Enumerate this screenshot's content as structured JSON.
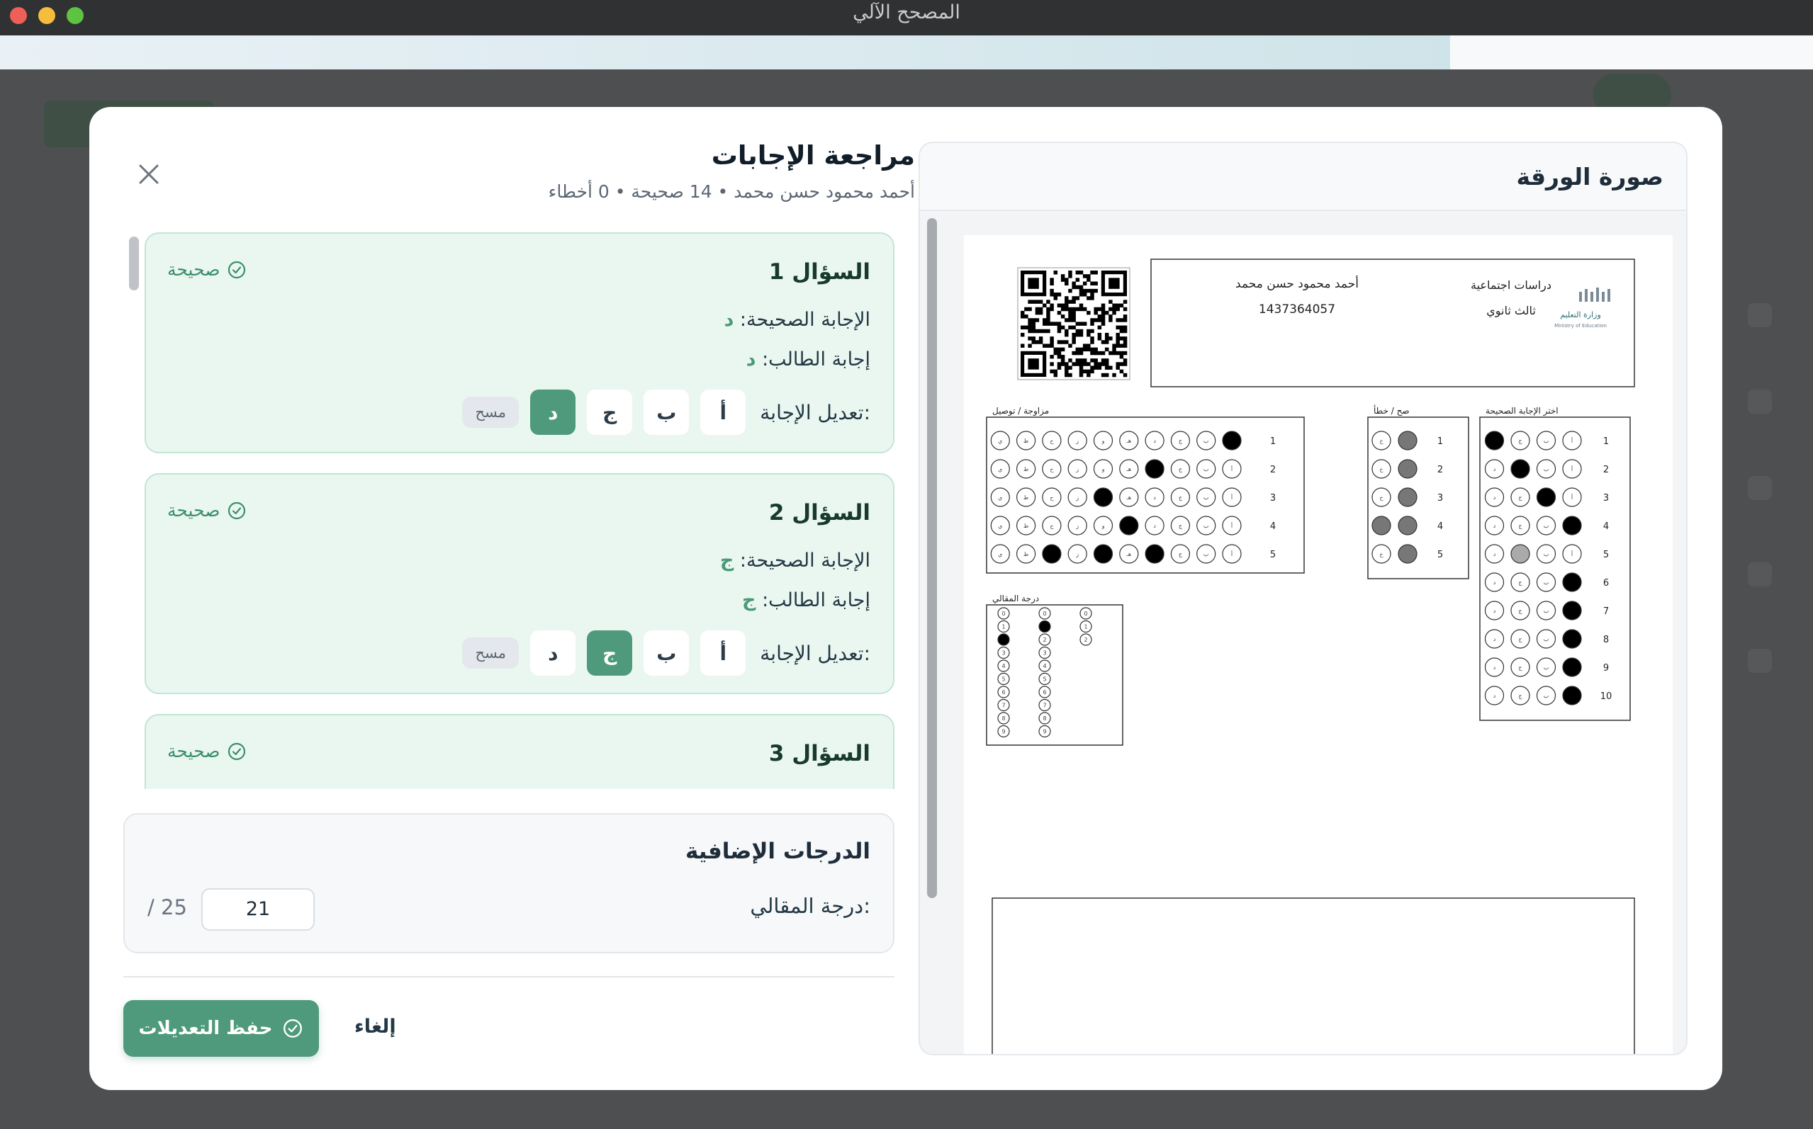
{
  "window": {
    "title": "المصحح الآلي"
  },
  "progress": 0.8,
  "review": {
    "title": "مراجعة الإجابات",
    "subtitle": "أحمد محمود حسن محمد • 14 صحيحة • 0 أخطاء",
    "correct_label": "الإجابة الصحيحة:",
    "student_label": "إجابة الطالب:",
    "edit_label": "تعديل الإجابة:",
    "options": [
      "أ",
      "ب",
      "ج",
      "د"
    ],
    "clear_label": "مسح",
    "questions": [
      {
        "title": "السؤال 1",
        "status": "صحيحة",
        "correct": "د",
        "student": "د",
        "selected": 3
      },
      {
        "title": "السؤال 2",
        "status": "صحيحة",
        "correct": "ج",
        "student": "ج",
        "selected": 2
      },
      {
        "title": "السؤال 3",
        "status": "صحيحة"
      }
    ]
  },
  "extra": {
    "title": "الدرجات الإضافية",
    "essay_label": "درجة المقالي:",
    "essay_value": "21",
    "essay_max": "/ 25"
  },
  "actions": {
    "save_label": "حفظ التعديلات",
    "cancel_label": "إلغاء"
  },
  "sheet_panel": {
    "title": "صورة الورقة"
  },
  "sheet": {
    "student_name": "أحمد محمود حسن محمد",
    "student_id": "1437364057",
    "subject": "دراسات اجتماعية",
    "grade": "ثالث ثانوي",
    "ministry_ar": "وزارة التعليم",
    "ministry_en": "Ministry of Education",
    "matching_title": "مزاوجة / توصيل",
    "tf_title": "صح / خطأ",
    "mcq_title": "اختر الإجابة الصحيحة",
    "essay_title": "درجة المقالي",
    "matching_letters": [
      "أ",
      "ب",
      "ج",
      "د",
      "هـ",
      "و",
      "ز",
      "ح",
      "ط",
      "ي"
    ],
    "tf_letters": [
      "ص",
      "خ"
    ],
    "mcq_letters": [
      "أ",
      "ب",
      "ج",
      "د"
    ],
    "matching_rows": [
      {
        "num": "1",
        "filled": [
          0
        ]
      },
      {
        "num": "2",
        "filled": [
          3
        ]
      },
      {
        "num": "3",
        "filled": [
          5
        ]
      },
      {
        "num": "4",
        "filled": [
          4
        ]
      },
      {
        "num": "5",
        "filled": [
          3,
          5,
          7
        ]
      }
    ],
    "tf_rows": [
      {
        "num": "1",
        "filled": [
          0
        ]
      },
      {
        "num": "2",
        "filled": [
          0
        ]
      },
      {
        "num": "3",
        "filled": [
          0
        ]
      },
      {
        "num": "4",
        "filled": [
          0,
          1
        ]
      },
      {
        "num": "5",
        "filled": [
          0
        ]
      }
    ],
    "mcq_rows": [
      {
        "num": "1",
        "filled": [
          3
        ]
      },
      {
        "num": "2",
        "filled": [
          2
        ]
      },
      {
        "num": "3",
        "filled": [
          1
        ]
      },
      {
        "num": "4",
        "filled": [
          0
        ]
      },
      {
        "num": "5",
        "filled": []
      },
      {
        "num": "6",
        "filled": [
          0
        ]
      },
      {
        "num": "7",
        "filled": [
          0
        ]
      },
      {
        "num": "8",
        "filled": [
          0
        ]
      },
      {
        "num": "9",
        "filled": [
          0
        ]
      },
      {
        "num": "10",
        "filled": [
          0
        ]
      }
    ],
    "essay_digits": [
      "0",
      "1",
      "2",
      "3",
      "4",
      "5",
      "6",
      "7",
      "8",
      "9"
    ],
    "essay_filled": [
      {
        "col": 1,
        "digit": 1
      },
      {
        "col": 0,
        "digit": 2
      }
    ]
  }
}
